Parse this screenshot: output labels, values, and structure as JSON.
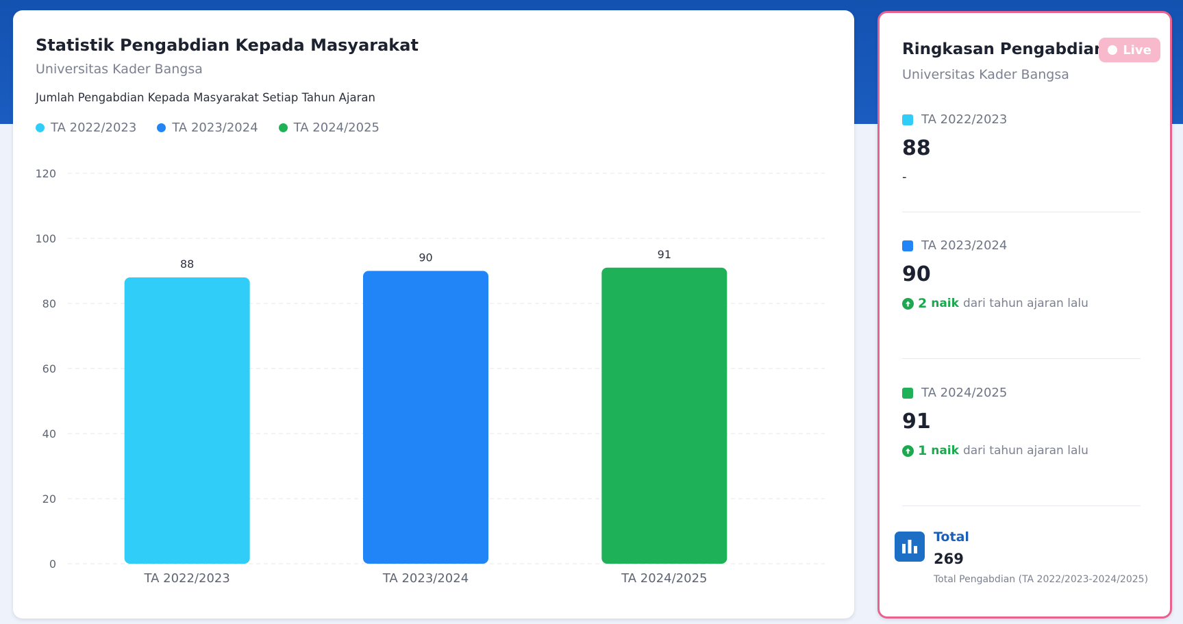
{
  "chart_card": {
    "title": "Statistik Pengabdian Kepada Masyarakat",
    "subtitle": "Universitas Kader Bangsa",
    "description": "Jumlah Pengabdian Kepada Masyarakat Setiap Tahun Ajaran"
  },
  "chart_data": {
    "type": "bar",
    "categories": [
      "TA 2022/2023",
      "TA 2023/2024",
      "TA 2024/2025"
    ],
    "values": [
      88,
      90,
      91
    ],
    "colors": [
      "#2fcdf8",
      "#2185f7",
      "#1fb157"
    ],
    "legend": [
      "TA 2022/2023",
      "TA 2023/2024",
      "TA 2024/2025"
    ],
    "legend_position": "top-left",
    "ylim": [
      0,
      120
    ],
    "yticks": [
      0,
      20,
      40,
      60,
      80,
      100,
      120
    ],
    "grid": true,
    "data_labels": true
  },
  "summary": {
    "title": "Ringkasan Pengabdian",
    "badge": "Live",
    "subtitle": "Universitas Kader Bangsa",
    "items": [
      {
        "label": "TA 2022/2023",
        "value": "88",
        "color": "#2fcdf8",
        "no_change": "-"
      },
      {
        "label": "TA 2023/2024",
        "value": "90",
        "color": "#2185f7",
        "change_amount": "2",
        "change_word": "naik",
        "change_text": "dari tahun ajaran lalu"
      },
      {
        "label": "TA 2024/2025",
        "value": "91",
        "color": "#1fb157",
        "change_amount": "1",
        "change_word": "naik",
        "change_text": "dari tahun ajaran lalu"
      }
    ],
    "total_label": "Total",
    "total_value": "269",
    "total_note": "Total Pengabdian (TA 2022/2023-2024/2025)",
    "icons": {
      "up": "arrow-up-circle-icon",
      "total": "bar-chart-icon"
    }
  }
}
